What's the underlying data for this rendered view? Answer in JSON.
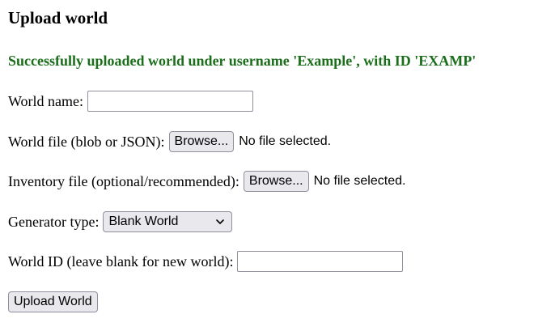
{
  "page": {
    "heading": "Upload world",
    "success_message": "Successfully uploaded world under username 'Example', with ID 'EXAMP'"
  },
  "form": {
    "world_name": {
      "label": "World name:",
      "value": ""
    },
    "world_file": {
      "label": "World file (blob or JSON):",
      "button_label": "Browse...",
      "status": "No file selected."
    },
    "inventory_file": {
      "label": "Inventory file (optional/recommended):",
      "button_label": "Browse...",
      "status": "No file selected."
    },
    "generator_type": {
      "label": "Generator type:",
      "selected": "Blank World",
      "icon": "chevron-down-icon"
    },
    "world_id": {
      "label": "World ID (leave blank for new world):",
      "value": ""
    },
    "submit_label": "Upload World"
  },
  "colors": {
    "success": "#1a6e1a",
    "button_bg": "#e9e9ed",
    "border": "#8f8f9d"
  }
}
